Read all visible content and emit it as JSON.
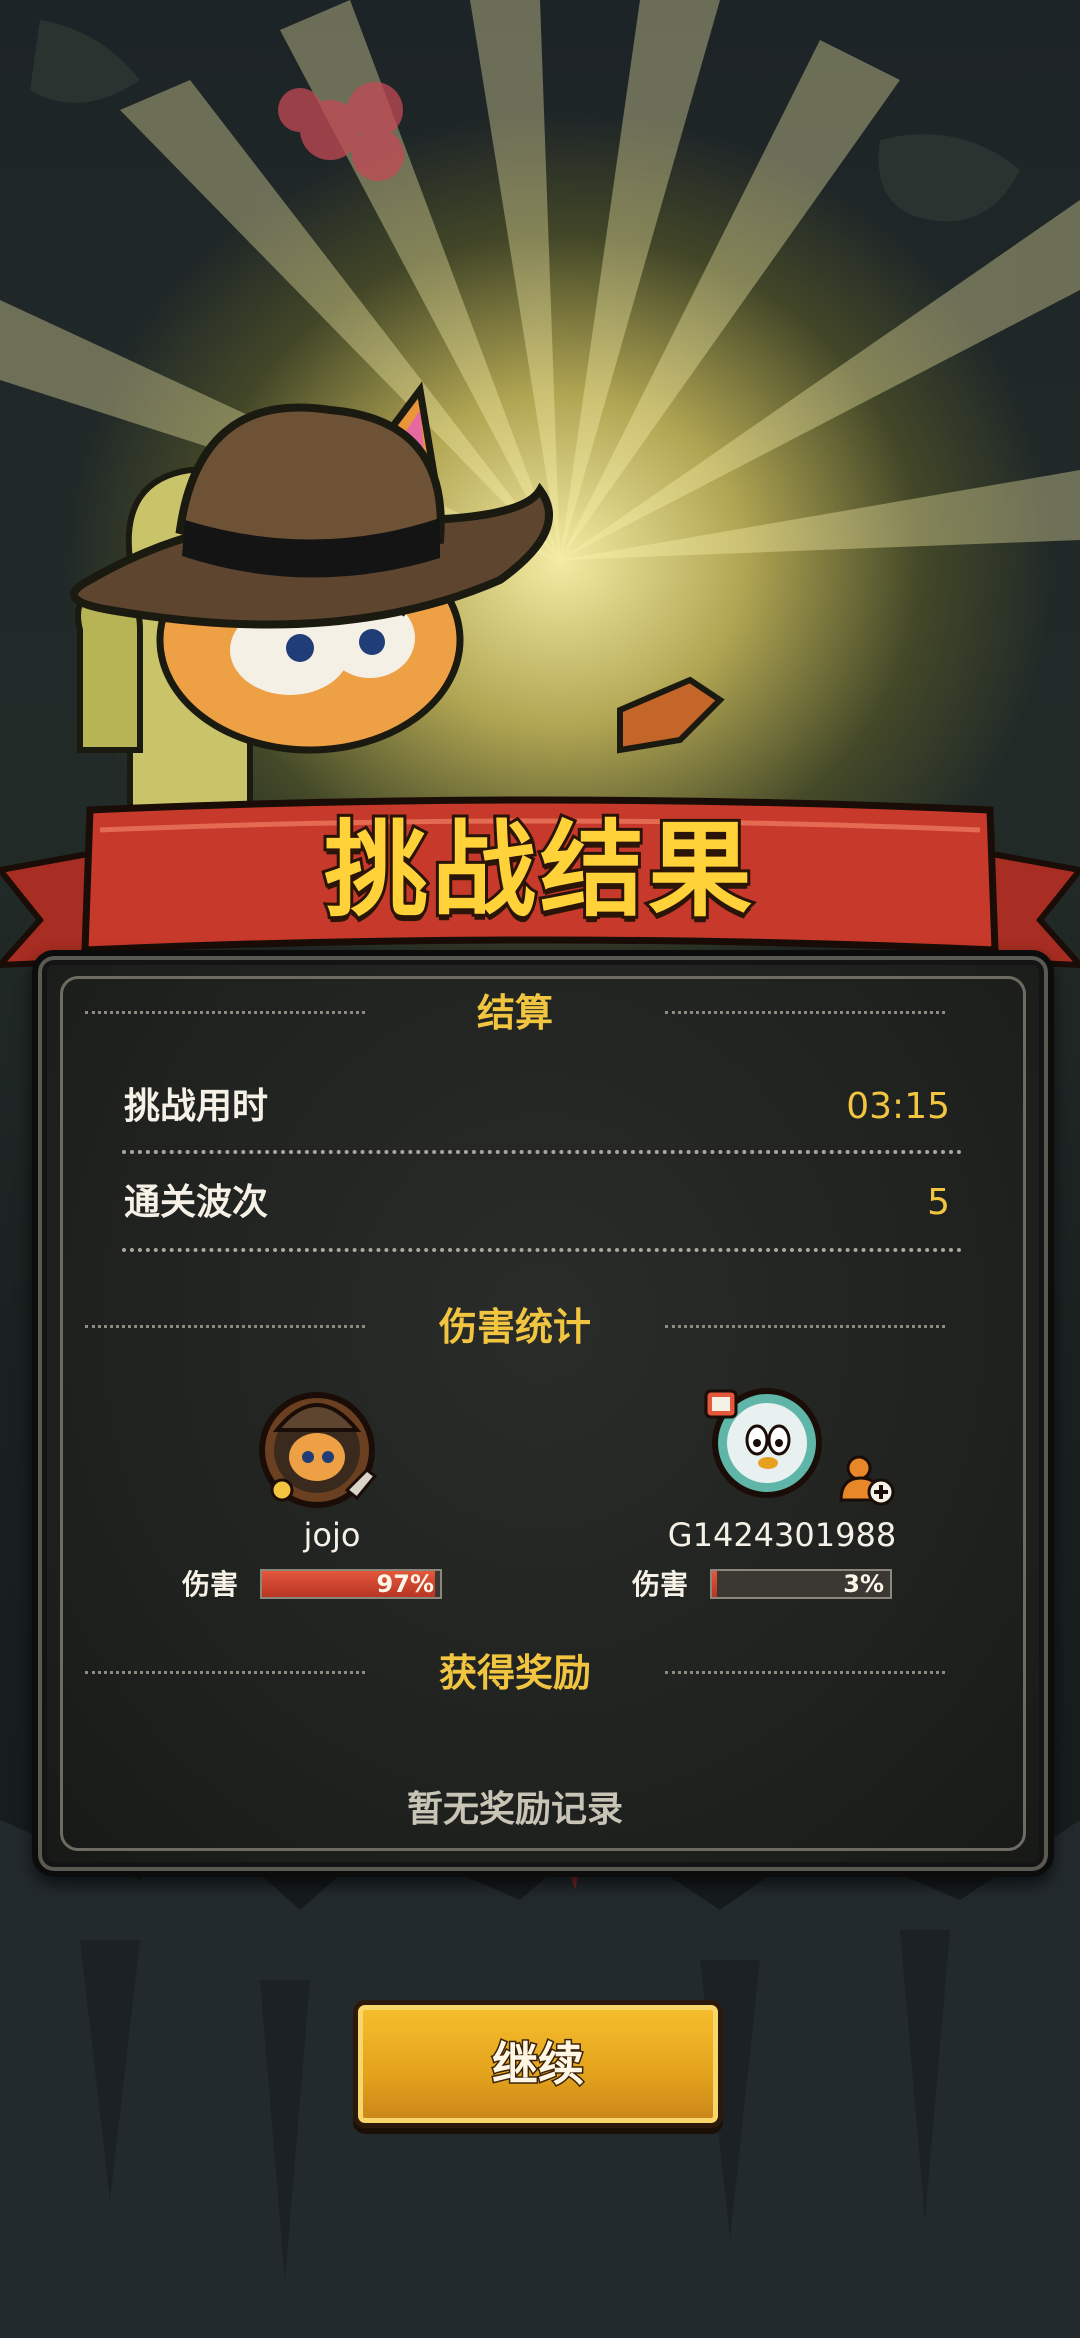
{
  "banner": {
    "title": "挑战结果"
  },
  "settlement": {
    "heading": "结算",
    "rows": [
      {
        "label": "挑战用时",
        "value": "03:15"
      },
      {
        "label": "通关波次",
        "value": "5"
      }
    ]
  },
  "damage": {
    "heading": "伤害统计",
    "players": [
      {
        "name": "jojo",
        "damage_label": "伤害",
        "percent": 97,
        "percent_text": "97%",
        "avatar_icon": "fox-cowboy-avatar-icon"
      },
      {
        "name": "G1424301988",
        "damage_label": "伤害",
        "percent": 3,
        "percent_text": "3%",
        "avatar_icon": "robot-avatar-icon",
        "badge_icon": "add-friend-icon"
      }
    ]
  },
  "rewards": {
    "heading": "获得奖励",
    "empty_text": "暂无奖励记录"
  },
  "continue_button": {
    "label": "继续"
  },
  "colors": {
    "title_gold": "#ffd23a",
    "accent_gold": "#f2c540",
    "banner_red": "#c7392b",
    "damage_bar": "#d4472f",
    "button_gold": "#e8a820"
  }
}
